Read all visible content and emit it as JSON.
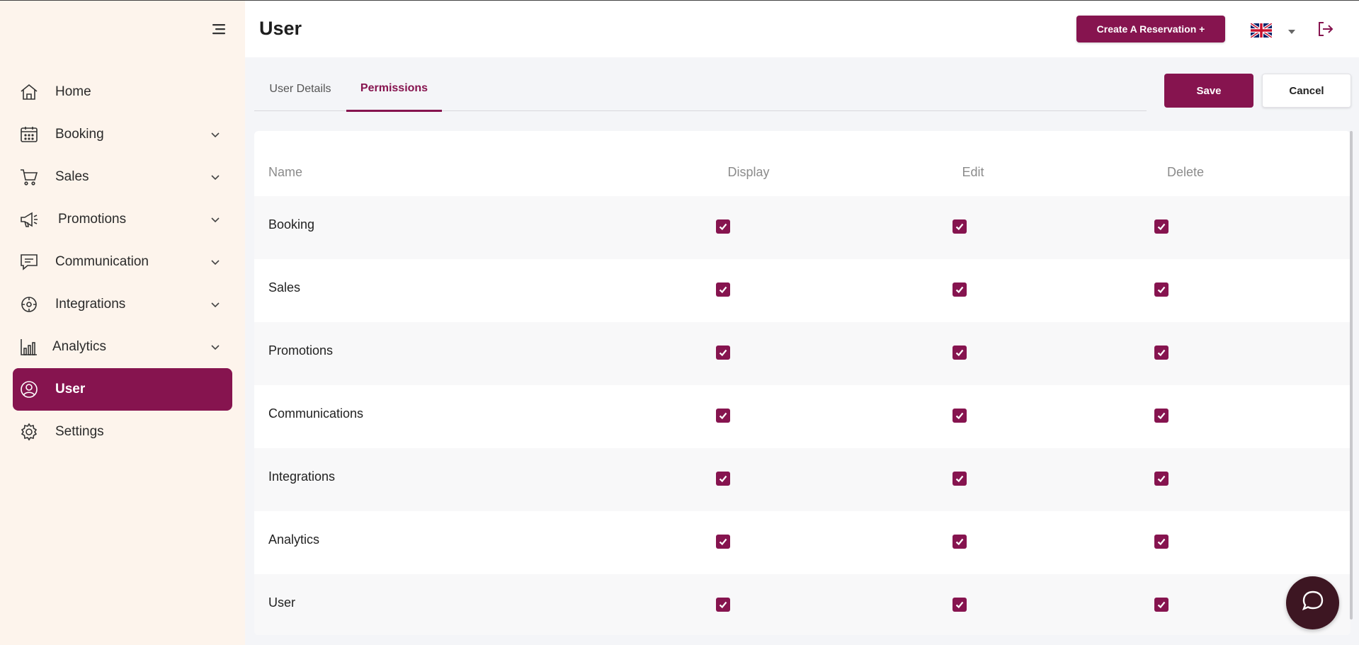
{
  "sidebar": {
    "items": [
      {
        "label": "Home",
        "icon": "home-icon",
        "has_chevron": false,
        "active": false
      },
      {
        "label": "Booking",
        "icon": "calendar-icon",
        "has_chevron": true,
        "active": false
      },
      {
        "label": "Sales",
        "icon": "cart-icon",
        "has_chevron": true,
        "active": false
      },
      {
        "label": "Promotions",
        "icon": "megaphone-icon",
        "has_chevron": true,
        "active": false
      },
      {
        "label": "Communication",
        "icon": "chat-icon",
        "has_chevron": true,
        "active": false
      },
      {
        "label": "Integrations",
        "icon": "integrations-icon",
        "has_chevron": true,
        "active": false
      },
      {
        "label": "Analytics",
        "icon": "bar-chart-icon",
        "has_chevron": true,
        "active": false
      },
      {
        "label": "User",
        "icon": "user-icon",
        "has_chevron": false,
        "active": true
      },
      {
        "label": "Settings",
        "icon": "gear-icon",
        "has_chevron": false,
        "active": false
      }
    ]
  },
  "header": {
    "title": "User",
    "reserve_label": "Create A Reservation +",
    "language_icon": "uk-flag-icon"
  },
  "tabs": [
    {
      "label": "User Details",
      "active": false
    },
    {
      "label": "Permissions",
      "active": true
    }
  ],
  "actions": {
    "save_label": "Save",
    "cancel_label": "Cancel"
  },
  "permissions": {
    "columns": [
      "Name",
      "Display",
      "Edit",
      "Delete"
    ],
    "rows": [
      {
        "name": "Booking",
        "display": true,
        "edit": true,
        "delete": true
      },
      {
        "name": "Sales",
        "display": true,
        "edit": true,
        "delete": true
      },
      {
        "name": "Promotions",
        "display": true,
        "edit": true,
        "delete": true
      },
      {
        "name": "Communications",
        "display": true,
        "edit": true,
        "delete": true
      },
      {
        "name": "Integrations",
        "display": true,
        "edit": true,
        "delete": true
      },
      {
        "name": "Analytics",
        "display": true,
        "edit": true,
        "delete": true
      },
      {
        "name": "User",
        "display": true,
        "edit": true,
        "delete": true
      }
    ]
  },
  "colors": {
    "accent": "#86144f",
    "sidebar_bg": "#fdf4ec",
    "chat_bubble": "#3d1622"
  }
}
